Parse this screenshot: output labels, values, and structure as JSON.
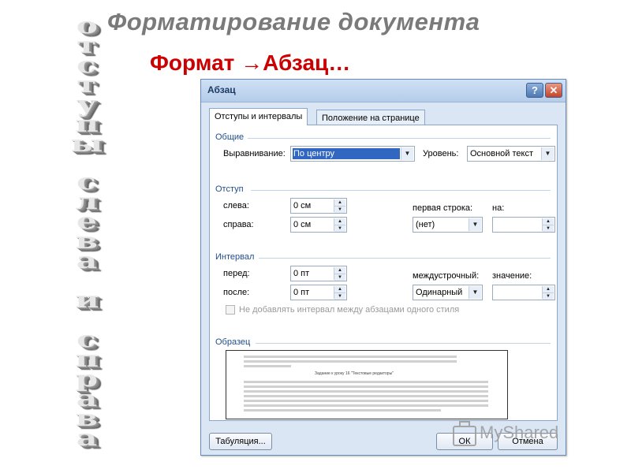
{
  "slide": {
    "title": "Форматирование документа",
    "subtitle": "Формат →Абзац…",
    "vertical_col1": [
      "о",
      "т",
      "с",
      "т",
      "у",
      "п",
      "ы"
    ],
    "vertical_col2": [
      "с",
      "л",
      "е",
      "в",
      "а",
      "",
      "и",
      "",
      "с",
      "п",
      "р",
      "а",
      "в",
      "а"
    ]
  },
  "dialog": {
    "title": "Абзац",
    "help_label": "?",
    "close_label": "✕",
    "tabs": [
      {
        "label": "Отступы и интервалы",
        "active": true
      },
      {
        "label": "Положение на странице",
        "active": false
      }
    ],
    "general": {
      "group_label": "Общие",
      "alignment_label": "Выравнивание:",
      "alignment_value": "По центру",
      "level_label": "Уровень:",
      "level_value": "Основной текст"
    },
    "indent": {
      "group_label": "Отступ",
      "left_label": "слева:",
      "left_value": "0 см",
      "right_label": "справа:",
      "right_value": "0 см",
      "first_line_label": "первая строка:",
      "first_line_value": "(нет)",
      "by_label": "на:",
      "by_value": ""
    },
    "spacing": {
      "group_label": "Интервал",
      "before_label": "перед:",
      "before_value": "0 пт",
      "after_label": "после:",
      "after_value": "0 пт",
      "line_spacing_label": "междустрочный:",
      "line_spacing_value": "Одинарный",
      "at_label": "значение:",
      "at_value": "",
      "no_space_checkbox_label": "Не добавлять интервал между абзацами одного стиля"
    },
    "preview": {
      "group_label": "Образец",
      "sample_heading": "Задание к уроку 16 \"Текстовые редакторы\""
    },
    "buttons": {
      "tabs_button": "Табуляция...",
      "ok_button": "ОК",
      "cancel_button": "Отмена"
    }
  },
  "watermark": {
    "text": "MyShared"
  }
}
